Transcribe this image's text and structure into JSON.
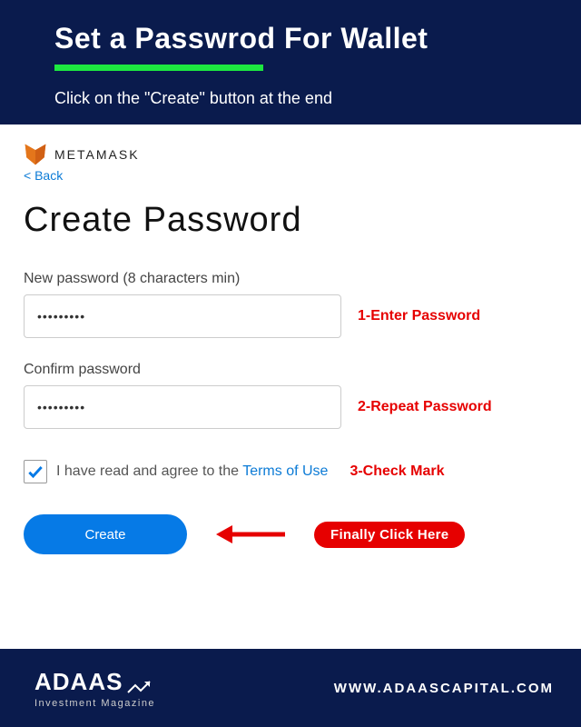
{
  "banner": {
    "title": "Set a Passwrod For Wallet",
    "subtitle": "Click on the \"Create\" button at the end"
  },
  "brand": {
    "name": "METAMASK",
    "back": "< Back"
  },
  "page": {
    "title": "Create Password"
  },
  "fields": {
    "new_password": {
      "label": "New password (8 characters min)",
      "value": "•••••••••",
      "annot": "1-Enter Password"
    },
    "confirm_password": {
      "label": "Confirm password",
      "value": "•••••••••",
      "annot": "2-Repeat Password"
    }
  },
  "terms": {
    "prefix": "I have read and agree to the ",
    "link": "Terms of Use",
    "annot": "3-Check Mark",
    "checked": true
  },
  "action": {
    "create": "Create",
    "badge": "Finally Click Here"
  },
  "footer": {
    "brand": "ADAAS",
    "tagline": "Investment Magazine",
    "url": "WWW.ADAASCAPITAL.COM"
  }
}
